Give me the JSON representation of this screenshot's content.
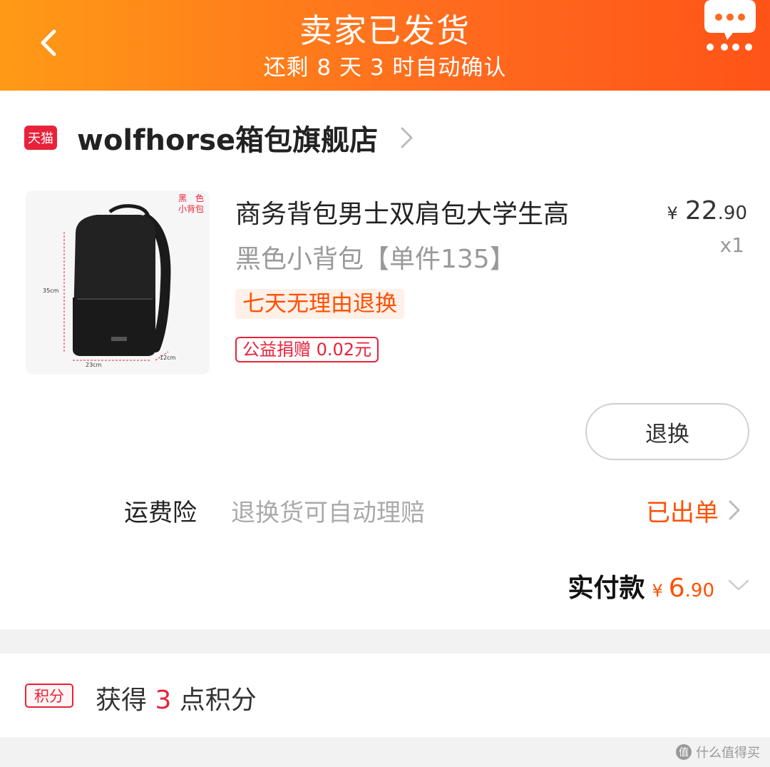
{
  "header": {
    "title": "卖家已发货",
    "subtitle": "还剩 8 天 3 时自动确认",
    "back_icon": "chevron-left-icon",
    "chat_icon": "chat-bubble-icon"
  },
  "shop": {
    "badge": "天猫",
    "name": "wolfhorse箱包旗舰店"
  },
  "product": {
    "title": "商务背包男士双肩包大学生高",
    "variant": "黑色小背包【单件135】",
    "price_symbol": "¥",
    "price_int": "22",
    "price_dec": ".90",
    "quantity": "x1",
    "tag_return": "七天无理由退换",
    "tag_charity": "公益捐赠 0.02元",
    "thumb_label": "黑　色\n小背包",
    "thumb_dims": {
      "height": "35cm",
      "width": "23cm",
      "depth": "12cm"
    }
  },
  "actions": {
    "return_button": "退换"
  },
  "insurance": {
    "label": "运费险",
    "description": "退换货可自动理赔",
    "status": "已出单"
  },
  "payment": {
    "label": "实付款",
    "symbol": "¥",
    "amount_int": "6",
    "amount_dec": ".90"
  },
  "points": {
    "badge": "积分",
    "prefix": "获得 ",
    "count": "3",
    "suffix": " 点积分"
  },
  "watermark": {
    "icon_text": "值",
    "text": "什么值得买"
  },
  "colors": {
    "header_start": "#ff9a16",
    "header_end": "#ff5418",
    "accent_orange": "#ff5000",
    "tmall_red": "#e8223a"
  }
}
